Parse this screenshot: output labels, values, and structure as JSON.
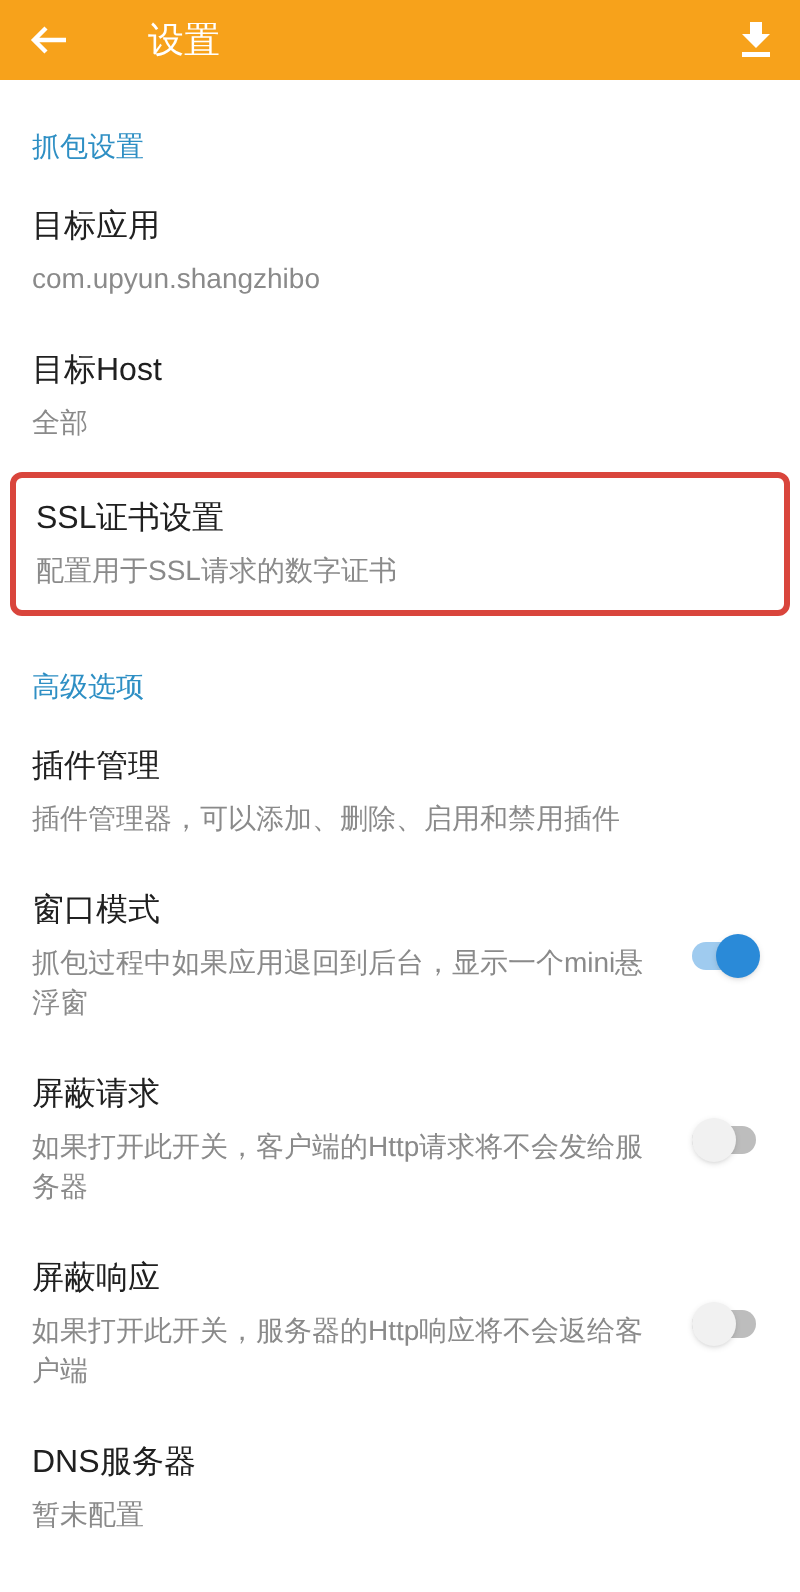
{
  "app_bar": {
    "title": "设置"
  },
  "sections": [
    {
      "header": "抓包设置",
      "items": [
        {
          "kind": "plain",
          "title": "目标应用",
          "subtitle": "com.upyun.shangzhibo",
          "highlighted": false
        },
        {
          "kind": "plain",
          "title": "目标Host",
          "subtitle": "全部",
          "highlighted": false
        },
        {
          "kind": "plain",
          "title": "SSL证书设置",
          "subtitle": "配置用于SSL请求的数字证书",
          "highlighted": true
        }
      ]
    },
    {
      "header": "高级选项",
      "items": [
        {
          "kind": "plain",
          "title": "插件管理",
          "subtitle": "插件管理器，可以添加、删除、启用和禁用插件",
          "highlighted": false
        },
        {
          "kind": "switch",
          "title": "窗口模式",
          "subtitle": "抓包过程中如果应用退回到后台，显示一个mini悬浮窗",
          "on": true,
          "highlighted": false
        },
        {
          "kind": "switch",
          "title": "屏蔽请求",
          "subtitle": "如果打开此开关，客户端的Http请求将不会发给服务器",
          "on": false,
          "highlighted": false
        },
        {
          "kind": "switch",
          "title": "屏蔽响应",
          "subtitle": "如果打开此开关，服务器的Http响应将不会返给客户端",
          "on": false,
          "highlighted": false
        },
        {
          "kind": "plain",
          "title": "DNS服务器",
          "subtitle": "暂未配置",
          "highlighted": false
        }
      ]
    }
  ]
}
